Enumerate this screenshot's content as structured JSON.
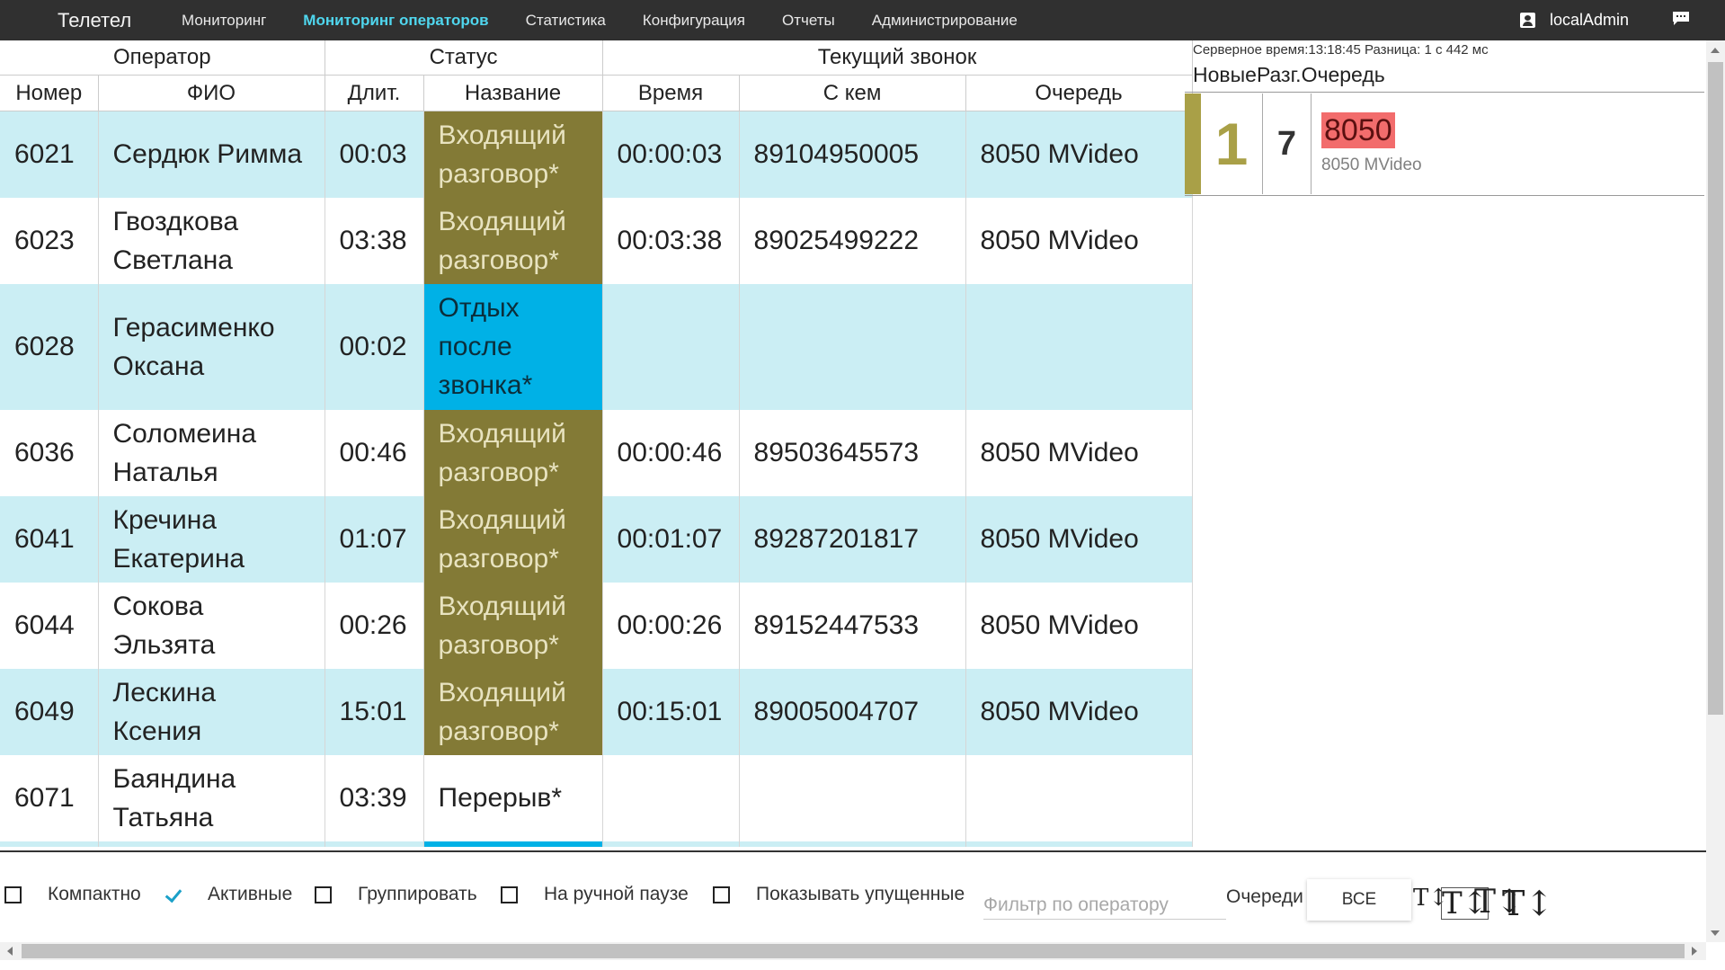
{
  "nav": {
    "brand": "Телетел",
    "items": [
      {
        "label": "Мониторинг"
      },
      {
        "label": "Мониторинг операторов"
      },
      {
        "label": "Статистика"
      },
      {
        "label": "Конфигурация"
      },
      {
        "label": "Отчеты"
      },
      {
        "label": "Администрирование"
      }
    ],
    "active_index": 1,
    "user": "localAdmin",
    "active_color": "#4fd6ee"
  },
  "table": {
    "group_headers": [
      "Оператор",
      "Статус",
      "Текущий звонок"
    ],
    "columns": [
      "Номер",
      "ФИО",
      "Длит.",
      "Название",
      "Время",
      "С кем",
      "Очередь"
    ],
    "rows": [
      {
        "num": "6021",
        "name": [
          "Сердюк Римма"
        ],
        "dur": "00:03",
        "status": [
          "Входящий",
          "разговор*"
        ],
        "status_type": "talk",
        "time": "00:00:03",
        "phone": "89104950005",
        "queue": "8050 MVideo"
      },
      {
        "num": "6023",
        "name": [
          "Гвоздкова",
          "Светлана"
        ],
        "dur": "03:38",
        "status": [
          "Входящий",
          "разговор*"
        ],
        "status_type": "talk",
        "time": "00:03:38",
        "phone": "89025499222",
        "queue": "8050 MVideo"
      },
      {
        "num": "6028",
        "name": [
          "Герасименко",
          "Оксана"
        ],
        "dur": "00:02",
        "status": [
          "Отдых",
          "после",
          "звонка*"
        ],
        "status_type": "rest",
        "time": "",
        "phone": "",
        "queue": ""
      },
      {
        "num": "6036",
        "name": [
          "Соломеина",
          "Наталья"
        ],
        "dur": "00:46",
        "status": [
          "Входящий",
          "разговор*"
        ],
        "status_type": "talk",
        "time": "00:00:46",
        "phone": "89503645573",
        "queue": "8050 MVideo"
      },
      {
        "num": "6041",
        "name": [
          "Кречина",
          "Екатерина"
        ],
        "dur": "01:07",
        "status": [
          "Входящий",
          "разговор*"
        ],
        "status_type": "talk",
        "time": "00:01:07",
        "phone": "89287201817",
        "queue": "8050 MVideo"
      },
      {
        "num": "6044",
        "name": [
          "Сокова",
          "Эльзята"
        ],
        "dur": "00:26",
        "status": [
          "Входящий",
          "разговор*"
        ],
        "status_type": "talk",
        "time": "00:00:26",
        "phone": "89152447533",
        "queue": "8050 MVideo"
      },
      {
        "num": "6049",
        "name": [
          "Лескина",
          "Ксения"
        ],
        "dur": "15:01",
        "status": [
          "Входящий",
          "разговор*"
        ],
        "status_type": "talk",
        "time": "00:15:01",
        "phone": "89005004707",
        "queue": "8050 MVideo"
      },
      {
        "num": "6071",
        "name": [
          "Баяндина",
          "Татьяна"
        ],
        "dur": "03:39",
        "status": [
          "Перерыв*"
        ],
        "status_type": "break",
        "time": "",
        "phone": "",
        "queue": ""
      }
    ],
    "colors": {
      "row_alt": "#cbeef4",
      "talk": "#837a36",
      "rest": "#00b1e6"
    }
  },
  "right_panel": {
    "server_time": "Серверное время:13:18:45  Разница: 1 с 442 мс",
    "headers": "НовыеРазг.Очередь",
    "queue": {
      "new": "1",
      "talking": "7",
      "name": "8050",
      "description": "8050 MVideo"
    },
    "colors": {
      "accent": "#a9a047",
      "queue_name_bg": "#f26c6c"
    }
  },
  "controls": {
    "checkboxes": [
      {
        "label": "Компактно",
        "checked": false
      },
      {
        "label": "Активные",
        "checked": true
      },
      {
        "label": "Группировать",
        "checked": false
      },
      {
        "label": "На ручной паузе",
        "checked": false
      },
      {
        "label": "Показывать упущенные",
        "checked": false
      }
    ],
    "filter_placeholder": "Фильтр по оператору",
    "queues_label": "Очереди",
    "queues_button": "ВСЕ",
    "font_size_icons": [
      "T↕",
      "T↕",
      "T↕",
      "T↕"
    ]
  }
}
